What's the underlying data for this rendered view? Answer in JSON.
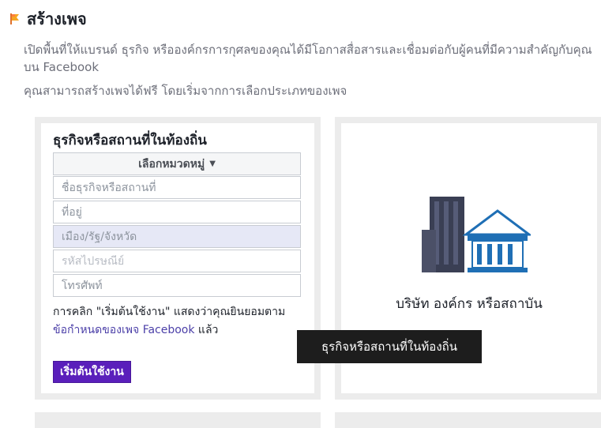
{
  "header": {
    "title": "สร้างเพจ",
    "description": "เปิดพื้นที่ให้แบรนด์ ธุรกิจ หรือองค์กรการกุศลของคุณได้มีโอกาสสื่อสารและเชื่อมต่อกับผู้คนที่มีความสำคัญกับคุณบน Facebook",
    "subdescription": "คุณสามารถสร้างเพจได้ฟรี โดยเริ่มจากการเลือกประเภทของเพจ"
  },
  "local_card": {
    "title": "ธุรกิจหรือสถานที่ในท้องถิ่น",
    "category_select": "เลือกหมวดหมู่",
    "fields": {
      "name": "ชื่อธุรกิจหรือสถานที่",
      "address": "ที่อยู่",
      "city": "เมือง/รัฐ/จังหวัด",
      "postal": "รหัสไปรษณีย์",
      "phone": "โทรศัพท์"
    },
    "terms_prefix": "การคลิก \"เริ่มต้นใช้งาน\" แสดงว่าคุณยินยอมตาม",
    "terms_link": "ข้อกำหนดของเพจ Facebook",
    "terms_suffix": " แล้ว",
    "start_button": "เริ่มต้นใช้งาน"
  },
  "company_card": {
    "label": "บริษัท องค์กร หรือสถาบัน"
  },
  "tooltip": {
    "text": "ธุรกิจหรือสถานที่ในท้องถิ่น"
  },
  "colors": {
    "accent": "#5a1fbb",
    "link": "#4b3fa8",
    "flag": "#f5a623"
  },
  "icons": {
    "flag": "flag-icon",
    "caret": "caret-down-icon",
    "company": "company-building-icon"
  }
}
